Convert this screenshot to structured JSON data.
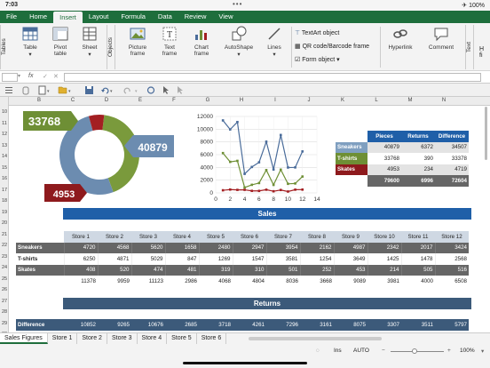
{
  "status": {
    "time": "7:03",
    "right": "✈ 100%",
    "dots": "•••"
  },
  "menu": [
    "File",
    "Home",
    "Insert",
    "Layout",
    "Formula",
    "Data",
    "Review",
    "View"
  ],
  "ribbon": {
    "group_tables": "Tables",
    "group_objects": "Objects",
    "group_text": "Text",
    "btn_table": "Table",
    "btn_pivot": "Pivot table",
    "btn_sheet": "Sheet",
    "btn_picture": "Picture frame",
    "btn_text": "Text frame",
    "btn_chart": "Chart frame",
    "btn_autoshape": "AutoShape",
    "btn_lines": "Lines",
    "opt_textart": "TextArt object",
    "opt_qr": "QR code/Barcode frame",
    "opt_form": "Form object",
    "btn_hyperlink": "Hyperlink",
    "btn_comment": "Comment",
    "cut_h": "H",
    "cut_fi": "fi"
  },
  "formula_bar": {
    "fx": "fx",
    "check": "✓",
    "cross": "✕"
  },
  "row_numbers": [
    "10",
    "11",
    "12",
    "13",
    "14",
    "15",
    "16",
    "17",
    "18",
    "19",
    "20",
    "21",
    "22",
    "23",
    "24",
    "25",
    "26",
    "27",
    "28",
    "29",
    "30"
  ],
  "columns": [
    "B",
    "C",
    "D",
    "E",
    "F",
    "G",
    "H",
    "I",
    "J",
    "K",
    "L",
    "M",
    "N"
  ],
  "donut": {
    "label_a": "33768",
    "label_b": "40879",
    "label_c": "4953",
    "values": [
      33768,
      40879,
      4953
    ],
    "colors": [
      "#7a9a3c",
      "#6c8cb0",
      "#a31f22"
    ]
  },
  "summary": {
    "headers": [
      "Pieces",
      "Returns",
      "Difference"
    ],
    "rows": [
      {
        "name": "Sneakers",
        "pieces": "40879",
        "returns": "6372",
        "diff": "34507",
        "color": "#7f9fc0"
      },
      {
        "name": "T-shirts",
        "pieces": "33768",
        "returns": "390",
        "diff": "33378",
        "color": "#6e8f35"
      },
      {
        "name": "Skates",
        "pieces": "4953",
        "returns": "234",
        "diff": "4719",
        "color": "#8e1a1d"
      }
    ],
    "totals": {
      "pieces": "79600",
      "returns": "6996",
      "diff": "72604"
    }
  },
  "chart_data": {
    "type": "line",
    "x": [
      1,
      2,
      3,
      4,
      5,
      6,
      7,
      8,
      9,
      10,
      11,
      12
    ],
    "series": [
      {
        "values": [
          11378,
          9959,
          11123,
          2986,
          4068,
          4804,
          8036,
          3668,
          9089,
          3981,
          4000,
          6508
        ],
        "color": "#4a6c9a"
      },
      {
        "values": [
          6250,
          4871,
          5029,
          847,
          1269,
          1547,
          3581,
          1254,
          3649,
          1425,
          1478,
          2568
        ],
        "color": "#6e8f35"
      },
      {
        "values": [
          408,
          520,
          474,
          481,
          319,
          310,
          501,
          252,
          453,
          214,
          505,
          516
        ],
        "color": "#a31f22"
      }
    ],
    "x_ticks": [
      "0",
      "2",
      "4",
      "6",
      "8",
      "10",
      "12",
      "14"
    ],
    "y_ticks": [
      "0",
      "2000",
      "4000",
      "6000",
      "8000",
      "10000",
      "12000"
    ],
    "xlim": [
      0,
      14
    ],
    "ylim": [
      0,
      12000
    ],
    "grid": true
  },
  "sales": {
    "title": "Sales",
    "headers": [
      "Store 1",
      "Store 2",
      "Store 3",
      "Store 4",
      "Store 5",
      "Store 6",
      "Store 7",
      "Store 8",
      "Store 9",
      "Store 10",
      "Store 11",
      "Store 12"
    ],
    "rows": [
      {
        "name": "Sneakers",
        "values": [
          "4720",
          "4568",
          "5620",
          "1658",
          "2480",
          "2947",
          "3954",
          "2162",
          "4987",
          "2342",
          "2017",
          "3424"
        ]
      },
      {
        "name": "T-shirts",
        "values": [
          "6250",
          "4871",
          "5029",
          "847",
          "1269",
          "1547",
          "3581",
          "1254",
          "3649",
          "1425",
          "1478",
          "2568"
        ]
      },
      {
        "name": "Skates",
        "values": [
          "408",
          "520",
          "474",
          "481",
          "319",
          "310",
          "501",
          "252",
          "453",
          "214",
          "505",
          "516"
        ]
      }
    ],
    "totals": [
      "11378",
      "9959",
      "11123",
      "2986",
      "4068",
      "4804",
      "8036",
      "3668",
      "9089",
      "3981",
      "4000",
      "6508"
    ]
  },
  "returns": {
    "title": "Returns"
  },
  "difference": {
    "name": "Difference",
    "values": [
      "10852",
      "9265",
      "10676",
      "2685",
      "3718",
      "4261",
      "7296",
      "3161",
      "8075",
      "3307",
      "3511",
      "5797"
    ]
  },
  "tabs": [
    "Sales Figures",
    "Store 1",
    "Store 2",
    "Store 3",
    "Store 4",
    "Store 5",
    "Store 6"
  ],
  "statusbar": {
    "ins": "Ins",
    "auto": "AUTO",
    "zoom": "100%",
    "minus": "−",
    "plus": "+"
  }
}
